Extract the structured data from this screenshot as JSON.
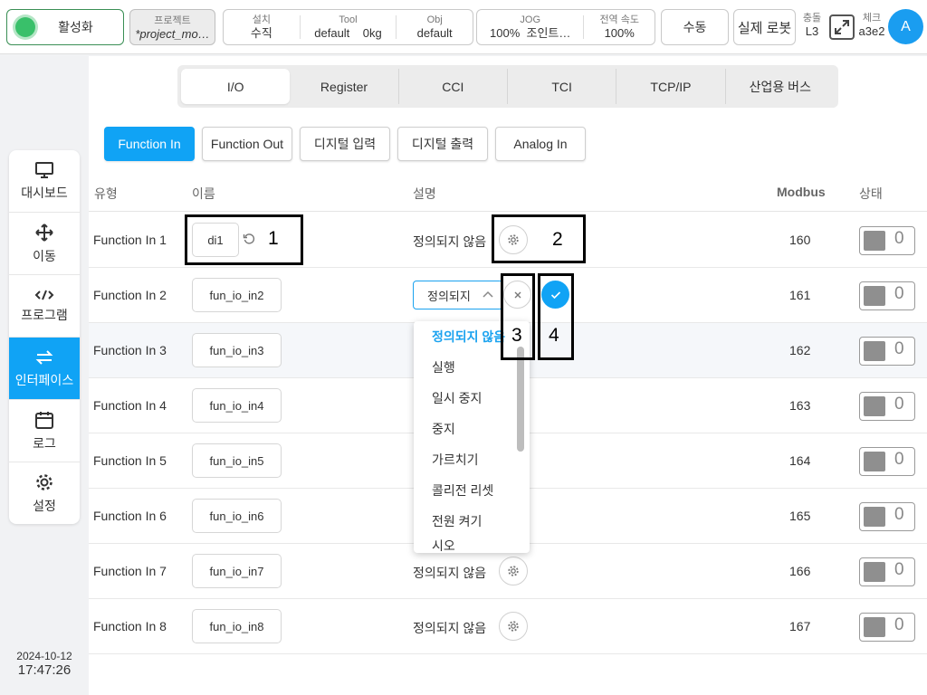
{
  "topbar": {
    "activate_label": "활성화",
    "project": {
      "title": "프로젝트",
      "name": "*project_mo…"
    },
    "install": {
      "install_label": "설치",
      "install_value": "수직",
      "tool_label": "Tool",
      "tool_value": "default",
      "tool_weight": "0kg",
      "obj_label": "Obj",
      "obj_value": "default"
    },
    "jog": {
      "jog_label": "JOG",
      "jog_value": "100%",
      "jog_mode": "조인트…",
      "speed_label": "전역 속도",
      "speed_value": "100%"
    },
    "manual_label": "수동",
    "real_robot_label": "실제 로봇",
    "collision": {
      "label": "충돌",
      "value": "L3"
    },
    "check": {
      "label": "체크",
      "value": "a3e2"
    },
    "avatar": "A"
  },
  "nav": [
    {
      "label": "대시보드",
      "icon": "monitor-icon"
    },
    {
      "label": "이동",
      "icon": "move-icon"
    },
    {
      "label": "프로그램",
      "icon": "code-icon"
    },
    {
      "label": "인터페이스",
      "icon": "interface-icon",
      "active": true
    },
    {
      "label": "로그",
      "icon": "calendar-icon"
    },
    {
      "label": "설정",
      "icon": "gear-icon"
    }
  ],
  "datetime": {
    "date": "2024-10-12",
    "time": "17:47:26"
  },
  "tabs": [
    "I/O",
    "Register",
    "CCI",
    "TCI",
    "TCP/IP",
    "산업용 버스"
  ],
  "subtabs": [
    "Function In",
    "Function Out",
    "디지털 입력",
    "디지털 출력",
    "Analog In"
  ],
  "table": {
    "headers": {
      "type": "유형",
      "name": "이름",
      "desc": "설명",
      "modbus": "Modbus",
      "status": "상태"
    },
    "rows": [
      {
        "type": "Function In 1",
        "name": "di1",
        "desc": "정의되지 않음",
        "modbus": "160",
        "status": "0"
      },
      {
        "type": "Function In 2",
        "name": "fun_io_in2",
        "desc": "정의되지",
        "modbus": "161",
        "status": "0"
      },
      {
        "type": "Function In 3",
        "name": "fun_io_in3",
        "desc": "",
        "modbus": "162",
        "status": "0"
      },
      {
        "type": "Function In 4",
        "name": "fun_io_in4",
        "desc": "",
        "modbus": "163",
        "status": "0"
      },
      {
        "type": "Function In 5",
        "name": "fun_io_in5",
        "desc": "",
        "modbus": "164",
        "status": "0"
      },
      {
        "type": "Function In 6",
        "name": "fun_io_in6",
        "desc": "",
        "modbus": "165",
        "status": "0"
      },
      {
        "type": "Function In 7",
        "name": "fun_io_in7",
        "desc": "정의되지 않음",
        "modbus": "166",
        "status": "0"
      },
      {
        "type": "Function In 8",
        "name": "fun_io_in8",
        "desc": "정의되지 않음",
        "modbus": "167",
        "status": "0"
      }
    ]
  },
  "dropdown": {
    "selected": "정의되지",
    "options": [
      "정의되지 않음",
      "실행",
      "일시 중지",
      "중지",
      "가르치기",
      "콜리전 리셋",
      "전원 켜기",
      "시오"
    ]
  },
  "annotations": [
    "1",
    "2",
    "3",
    "4"
  ],
  "colors": {
    "accent": "#10a3f5",
    "active_green": "#39c06a"
  }
}
